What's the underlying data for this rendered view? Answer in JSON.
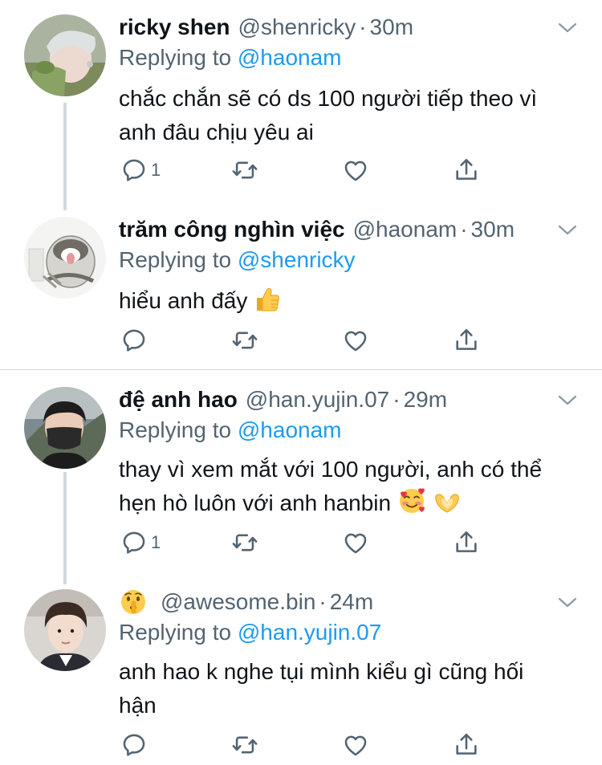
{
  "tweets": [
    {
      "name": "ricky shen",
      "handle": "@shenricky",
      "time": "30m",
      "replying_prefix": "Replying to",
      "replying_to": "@haonam",
      "text_lines": [
        "chắc chắn sẽ có ds 100 người tiếp theo vì",
        "anh đâu chịu yêu ai"
      ],
      "reply_count": "1"
    },
    {
      "name": "trăm công nghìn việc",
      "handle": "@haonam",
      "time": "30m",
      "replying_prefix": "Replying to",
      "replying_to": "@shenricky",
      "text_lines": [
        "hiểu anh đấy"
      ],
      "reply_count": ""
    },
    {
      "name": "đệ anh hao",
      "handle": "@han.yujin.07",
      "time": "29m",
      "replying_prefix": "Replying to",
      "replying_to": "@haonam",
      "text_lines": [
        "thay vì xem mắt với 100 người, anh có thể",
        "hẹn hò luôn với anh hanbin"
      ],
      "reply_count": "1"
    },
    {
      "name": "",
      "handle": "@awesome.bin",
      "time": "24m",
      "replying_prefix": "Replying to",
      "replying_to": "@han.yujin.07",
      "text_lines": [
        "anh hao k nghe tụi mình kiểu gì cũng hối",
        "hận"
      ],
      "reply_count": ""
    }
  ],
  "separator_dot": "·",
  "icons": {
    "reply": "reply-icon",
    "retweet": "retweet-icon",
    "like": "heart-icon",
    "share": "share-icon",
    "more": "chevron-down-icon",
    "emojis": [
      "thumbs-up-emoji",
      "smiling-face-with-hearts-emoji",
      "heart-hands-emoji",
      "shushing-face-emoji"
    ]
  },
  "colors": {
    "link": "#1d9bf0",
    "secondary": "#536471",
    "divider": "#cfd9de"
  }
}
